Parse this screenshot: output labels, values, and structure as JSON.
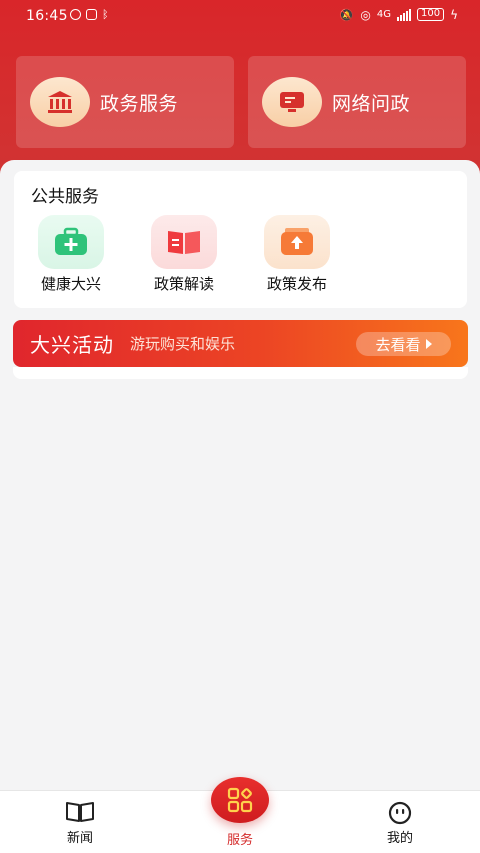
{
  "status_bar": {
    "time": "16:45",
    "network": "4G",
    "battery": "100"
  },
  "top_cards": [
    {
      "label": "政务服务",
      "icon": "government-building-icon"
    },
    {
      "label": "网络问政",
      "icon": "monitor-message-icon"
    }
  ],
  "public_services": {
    "title": "公共服务",
    "items": [
      {
        "label": "健康大兴",
        "icon": "medical-kit-icon",
        "color": "#2fc37a"
      },
      {
        "label": "政策解读",
        "icon": "open-book-icon",
        "color": "#ef3a3e"
      },
      {
        "label": "政策发布",
        "icon": "upload-box-icon",
        "color": "#f67a37"
      }
    ]
  },
  "banner": {
    "title": "大兴活动",
    "subtitle": "游玩购买和娱乐",
    "button_label": "去看看"
  },
  "tabbar": {
    "items": [
      {
        "label": "新闻",
        "icon": "open-book-outline-icon"
      },
      {
        "label": "服务",
        "icon": "grid-diamond-icon",
        "active": true
      },
      {
        "label": "我的",
        "icon": "smiley-face-icon"
      }
    ]
  },
  "colors": {
    "header_red": "#d9262a",
    "accent_red": "#d42a2a",
    "banner_orange": "#f8761b"
  }
}
